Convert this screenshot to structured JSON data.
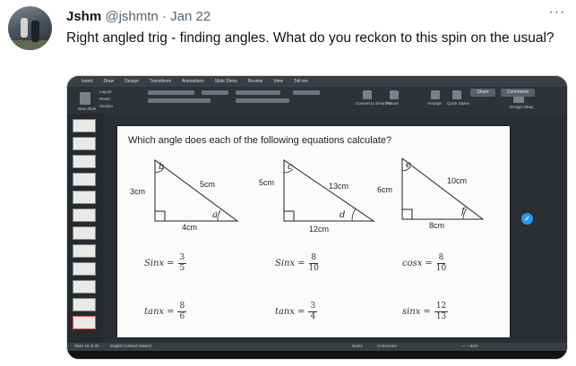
{
  "tweet": {
    "author_name": "Jshm",
    "handle": "@jshmtn",
    "separator": "·",
    "date": "Jan 22",
    "more_label": "···",
    "text": "Right angled trig - finding angles. What do you reckon to this spin on the usual?"
  },
  "screen": {
    "ribbon_tabs": [
      "Insert",
      "Draw",
      "Design",
      "Transitions",
      "Animations",
      "Slide Show",
      "Review",
      "View",
      "Tell me"
    ],
    "share_label": "Share",
    "comments_label": "Comments",
    "ribbon_labels": {
      "new_slide": "New Slide",
      "layout": "Layout",
      "reset": "Reset",
      "section": "Section",
      "convert": "Convert to SmartArt",
      "picture": "Picture",
      "arrange": "Arrange",
      "quick_styles": "Quick Styles",
      "design_ideas": "Design Ideas"
    },
    "status_left": "Slide 10 of 30",
    "status_lang": "English (United States)",
    "status_notes": "Notes",
    "status_comments": "Comments",
    "status_zoom": "— + 81%",
    "badge_icon": "shield-icon"
  },
  "slide": {
    "title": "Which angle does each of the following equations calculate?",
    "triangles": [
      {
        "angle1": "b",
        "hyp": "5cm",
        "side": "3cm",
        "base": "4cm",
        "angle2": "a"
      },
      {
        "angle1": "c",
        "hyp": "13cm",
        "side": "5cm",
        "base": "12cm",
        "angle2": "d"
      },
      {
        "angle1": "e",
        "hyp": "10cm",
        "side": "6cm",
        "base": "8cm",
        "angle2": "f"
      }
    ],
    "equations": [
      {
        "fn": "Sinx",
        "num": "3",
        "den": "5"
      },
      {
        "fn": "Sinx",
        "num": "8",
        "den": "10"
      },
      {
        "fn": "cosx",
        "num": "8",
        "den": "10"
      },
      {
        "fn": "tanx",
        "num": "8",
        "den": "6"
      },
      {
        "fn": "tanx",
        "num": "3",
        "den": "4"
      },
      {
        "fn": "sinx",
        "num": "12",
        "den": "13"
      }
    ],
    "eq_sign": "="
  }
}
